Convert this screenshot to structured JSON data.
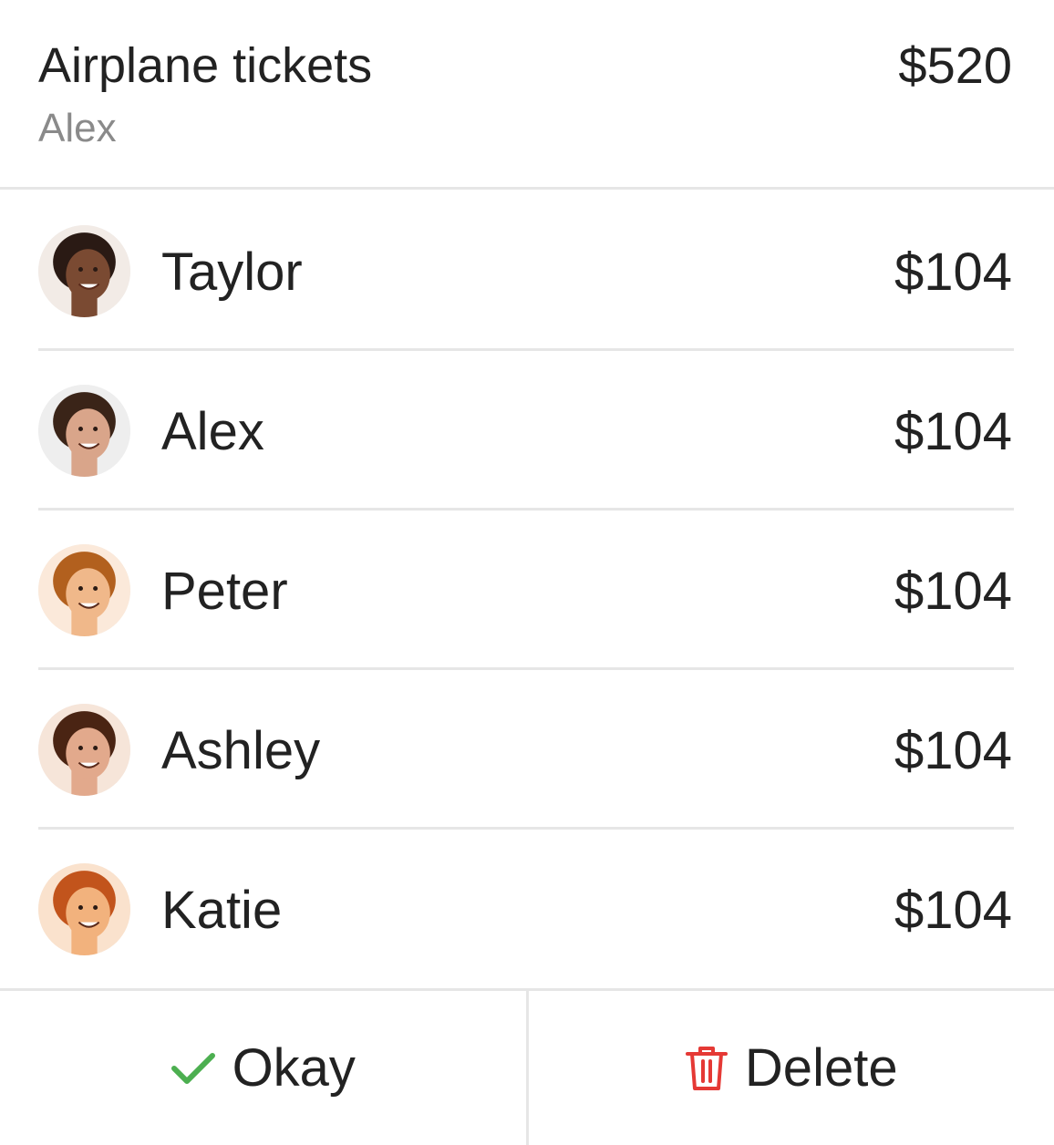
{
  "expense": {
    "title": "Airplane tickets",
    "paid_by": "Alex",
    "total": "$520"
  },
  "participants": [
    {
      "name": "Taylor",
      "amount": "$104",
      "skin": "#7a4a32",
      "hair": "#2a1a14",
      "bg": "#f2ebe6"
    },
    {
      "name": "Alex",
      "amount": "$104",
      "skin": "#d9a58a",
      "hair": "#3a2418",
      "bg": "#eeeeee"
    },
    {
      "name": "Peter",
      "amount": "$104",
      "skin": "#f0b88a",
      "hair": "#b2601e",
      "bg": "#fbe9da"
    },
    {
      "name": "Ashley",
      "amount": "$104",
      "skin": "#e2a98c",
      "hair": "#4a2413",
      "bg": "#f6e5d9"
    },
    {
      "name": "Katie",
      "amount": "$104",
      "skin": "#f2b27d",
      "hair": "#c2541c",
      "bg": "#fae2cd"
    }
  ],
  "actions": {
    "okay_label": "Okay",
    "delete_label": "Delete",
    "okay_icon": "checkmark-icon",
    "delete_icon": "trash-icon",
    "okay_color": "#4caf50",
    "delete_color": "#e53935"
  }
}
